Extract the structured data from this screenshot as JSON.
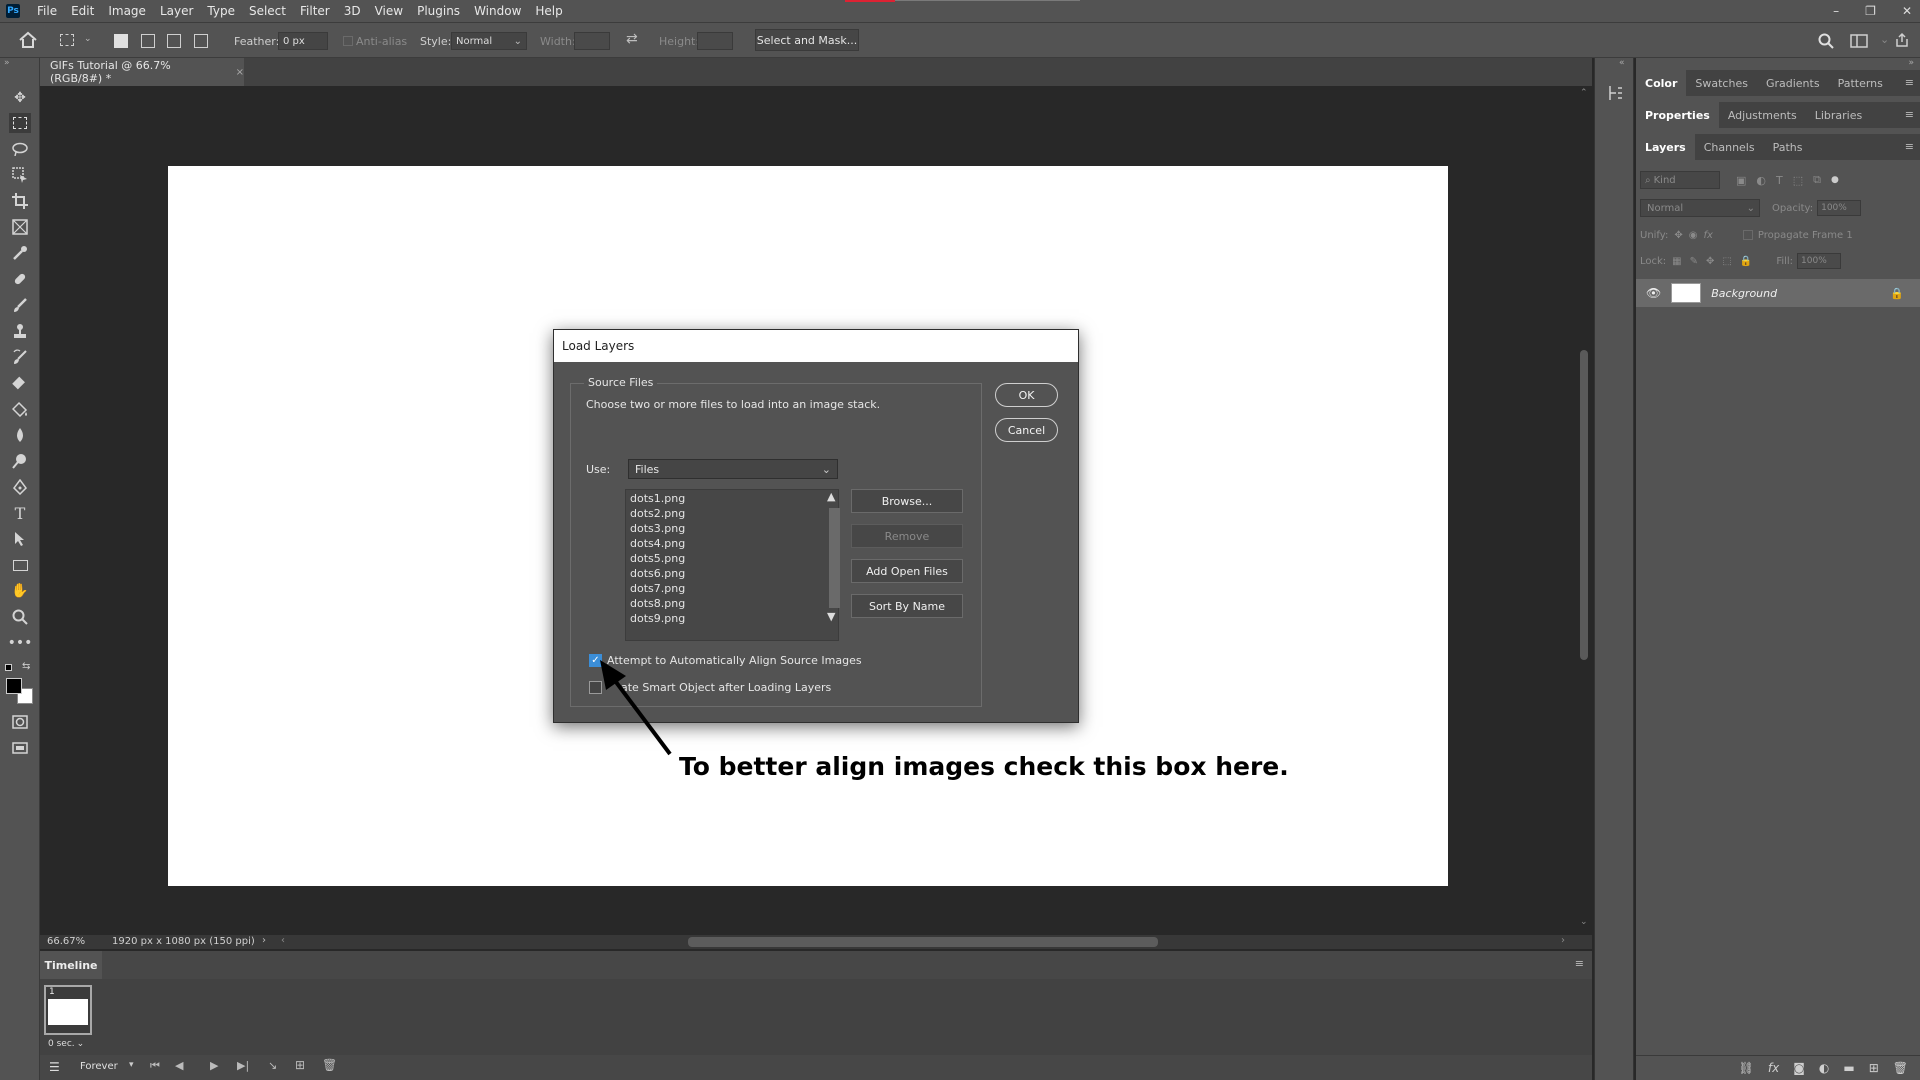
{
  "app": {
    "logo": "Ps"
  },
  "menubar": {
    "items": [
      "File",
      "Edit",
      "Image",
      "Layer",
      "Type",
      "Select",
      "Filter",
      "3D",
      "View",
      "Plugins",
      "Window",
      "Help"
    ]
  },
  "window_controls": {
    "minimize": "–",
    "restore": "❐",
    "close": "✕"
  },
  "options_bar": {
    "feather_label": "Feather:",
    "feather_value": "0 px",
    "antialias_label": "Anti-alias",
    "style_label": "Style:",
    "style_value": "Normal",
    "width_label": "Width:",
    "height_label": "Height:",
    "select_mask_label": "Select and Mask..."
  },
  "document": {
    "tab_title": "GIFs Tutorial @ 66.7% (RGB/8#) *",
    "tab_close": "×"
  },
  "status_bar": {
    "zoom": "66.67%",
    "doc_info": "1920 px x 1080 px (150 ppi)"
  },
  "timeline": {
    "tab_label": "Timeline",
    "frame_number": "1",
    "frame_delay": "0 sec.",
    "loop_value": "Forever"
  },
  "panels": {
    "group1_tabs": [
      "Color",
      "Swatches",
      "Gradients",
      "Patterns"
    ],
    "group2_tabs": [
      "Properties",
      "Adjustments",
      "Libraries"
    ],
    "group3_tabs": [
      "Layers",
      "Channels",
      "Paths"
    ],
    "layers": {
      "filter_placeholder": "Kind",
      "blend_mode": "Normal",
      "opacity_label": "Opacity:",
      "opacity_value": "100%",
      "unify_label": "Unify:",
      "propagate_label": "Propagate Frame 1",
      "lock_label": "Lock:",
      "fill_label": "Fill:",
      "fill_value": "100%",
      "items": [
        {
          "name": "Background"
        }
      ]
    }
  },
  "dialog": {
    "title": "Load Layers",
    "group_title": "Source Files",
    "instructions": "Choose two or more files to load into an image stack.",
    "use_label": "Use:",
    "use_value": "Files",
    "files": [
      "dots1.png",
      "dots2.png",
      "dots3.png",
      "dots4.png",
      "dots5.png",
      "dots6.png",
      "dots7.png",
      "dots8.png",
      "dots9.png"
    ],
    "browse_label": "Browse...",
    "remove_label": "Remove",
    "add_open_files_label": "Add Open Files",
    "sort_by_name_label": "Sort By Name",
    "ok_label": "OK",
    "cancel_label": "Cancel",
    "auto_align_label": "Attempt to Automatically Align Source Images",
    "auto_align_checked": true,
    "smart_object_label": "ate Smart Object after Loading Layers",
    "smart_object_checked": false
  },
  "annotation": {
    "text": "To better align images check this box here.",
    "arrow_color": "#000000"
  },
  "colors": {
    "accent": "#3b8ed8",
    "ui_bg": "#535353",
    "canvas_bg": "#282828"
  }
}
